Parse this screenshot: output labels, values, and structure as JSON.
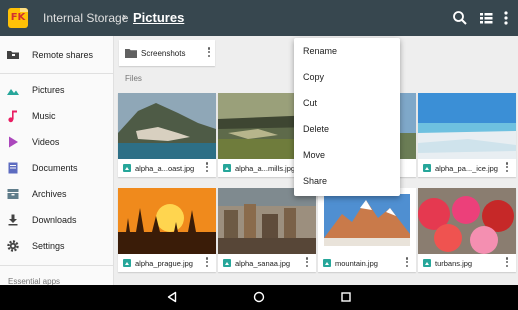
{
  "app": {
    "logo_text": "FK",
    "breadcrumb_root": "Internal Storage",
    "breadcrumb_sep": "›",
    "breadcrumb_current": "Pictures",
    "actions": [
      "search-icon",
      "view-list-icon",
      "overflow-menu-icon"
    ]
  },
  "sidebar": {
    "top_items": [
      {
        "label": "Remote shares",
        "icon": "network-folder-icon"
      }
    ],
    "items": [
      {
        "label": "Pictures",
        "icon": "image-icon",
        "color": "#26a69a"
      },
      {
        "label": "Music",
        "icon": "music-note-icon",
        "color": "#e91e63"
      },
      {
        "label": "Videos",
        "icon": "play-icon",
        "color": "#ab47bc"
      },
      {
        "label": "Documents",
        "icon": "document-icon",
        "color": "#5c6bc0"
      },
      {
        "label": "Archives",
        "icon": "archive-icon",
        "color": "#607d8b"
      },
      {
        "label": "Downloads",
        "icon": "download-icon",
        "color": "#424242"
      },
      {
        "label": "Settings",
        "icon": "gear-icon",
        "color": "#424242"
      }
    ],
    "section_label": "Essential apps"
  },
  "main": {
    "folders": [
      {
        "name": "Screenshots",
        "icon": "folder-icon"
      }
    ],
    "files_label": "Files",
    "files": [
      {
        "name": "alpha_a...oast.jpg"
      },
      {
        "name": "alpha_a...mills.jpg"
      },
      {
        "name": ""
      },
      {
        "name": "alpha_pa..._ice.jpg"
      },
      {
        "name": "alpha_prague.jpg"
      },
      {
        "name": "alpha_sanaa.jpg"
      },
      {
        "name": "mountain.jpg"
      },
      {
        "name": "turbans.jpg"
      }
    ]
  },
  "context_menu": {
    "items": [
      "Rename",
      "Copy",
      "Cut",
      "Delete",
      "Move",
      "Share"
    ]
  },
  "navbar": {
    "buttons": [
      "back-icon",
      "home-icon",
      "recents-icon"
    ]
  },
  "colors": {
    "appbar": "#37474f",
    "accent": "#ffc107"
  }
}
